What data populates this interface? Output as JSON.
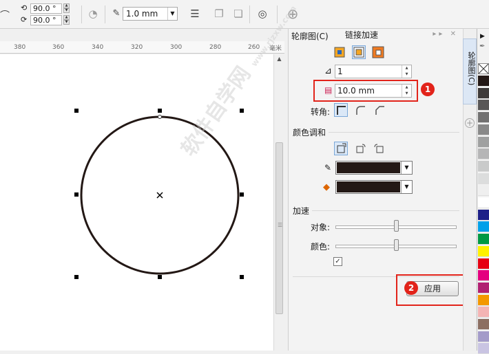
{
  "toolbar": {
    "angle1": "90.0 °",
    "angle2": "90.0 °",
    "outline_width": "1.0 mm"
  },
  "ruler": {
    "ticks": [
      "380",
      "360",
      "340",
      "320",
      "300",
      "280",
      "260"
    ],
    "unit": "毫米"
  },
  "watermark": {
    "text": "软件自学网",
    "url": "www.rjzxw.com"
  },
  "docker": {
    "title": "轮廓图(C)",
    "steps_value": "1",
    "offset_value": "10.0 mm",
    "corner_label": "转角:",
    "color_blend_label": "颜色调和",
    "accel_label": "加速",
    "object_label": "对象:",
    "color_label": "颜色:",
    "link_accel_label": "链接加速",
    "apply_label": "应用",
    "object_accel": 0.5,
    "color_accel": 0.5,
    "outline_color": "#231815",
    "fill_color": "#231815"
  },
  "vertical_tab": {
    "label": "轮廓图(C)"
  },
  "annotations": {
    "badge1": "1",
    "badge2": "2"
  },
  "palette": [
    "#231815",
    "#3e3a39",
    "#595757",
    "#727171",
    "#898989",
    "#9fa0a0",
    "#b5b5b6",
    "#c9caca",
    "#dcdddd",
    "#efefef",
    "#ffffff",
    "#1d2088",
    "#00a0e9",
    "#009944",
    "#fff100",
    "#e60012",
    "#e4007f",
    "#b11f72",
    "#f39800",
    "#f4b4b4",
    "#8c6f62",
    "#a39bc9",
    "#c9c4e2"
  ]
}
